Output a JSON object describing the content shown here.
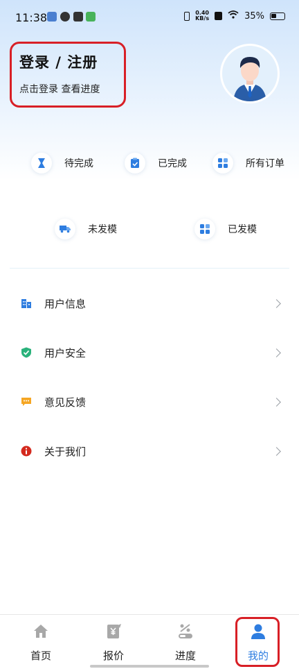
{
  "status_bar": {
    "time": "11:38",
    "net_speed_top": "0.40",
    "net_speed_bottom": "KB/s",
    "battery": "35%"
  },
  "header": {
    "login_title": "登录 / 注册",
    "login_sub": "点击登录 查看进度"
  },
  "orders": {
    "pending": "待完成",
    "completed": "已完成",
    "all": "所有订单",
    "unshipped": "未发模",
    "shipped": "已发模"
  },
  "menu": {
    "user_info": "用户信息",
    "user_security": "用户安全",
    "feedback": "意见反馈",
    "about": "关于我们"
  },
  "tabbar": {
    "home": "首页",
    "quote": "报价",
    "progress": "进度",
    "mine": "我的"
  },
  "colors": {
    "accent": "#2e7de0",
    "highlight_box": "#d81f26",
    "security_green": "#2ab27b",
    "feedback_orange": "#f5a623",
    "about_red": "#d42a1e"
  }
}
